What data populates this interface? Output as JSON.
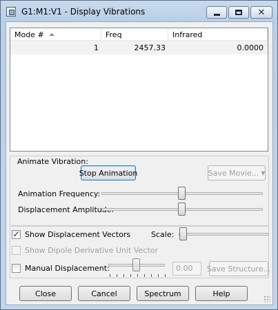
{
  "window": {
    "title": "G1:M1:V1 - Display Vibrations",
    "icons": {
      "app": "gaussview-window-icon",
      "minimize": "minimize-icon",
      "maximize": "maximize-icon",
      "close": "close-icon"
    },
    "close_glyph": "✕"
  },
  "list": {
    "columns": [
      "Mode #",
      "Freq",
      "Infrared"
    ],
    "sort_indicator": "sort-ascending-icon",
    "rows": [
      {
        "mode": "1",
        "freq": "2457.33",
        "infrared": "0.0000"
      }
    ]
  },
  "animate": {
    "section_label": "Animate Vibration:",
    "stop_button": "Stop Animation",
    "save_movie_button": "Save Movie...",
    "frequency_label": "Animation Frequency:",
    "frequency_level": 0.5,
    "amplitude_label": "Displacement Amplitude:",
    "amplitude_level": 0.5
  },
  "options": {
    "show_vectors_label": "Show Displacement Vectors",
    "show_vectors_checked": "✓",
    "scale_label": "Scale:",
    "scale_level": 0.05,
    "dipole_label": "Show Dipole Derivative Unit Vector",
    "manual_label": "Manual Displacement:",
    "manual_level": 0.5,
    "manual_value": "0.00",
    "save_structure_button": "Save Structure..."
  },
  "buttons": {
    "close": "Close",
    "cancel": "Cancel",
    "spectrum": "Spectrum",
    "help": "Help"
  }
}
